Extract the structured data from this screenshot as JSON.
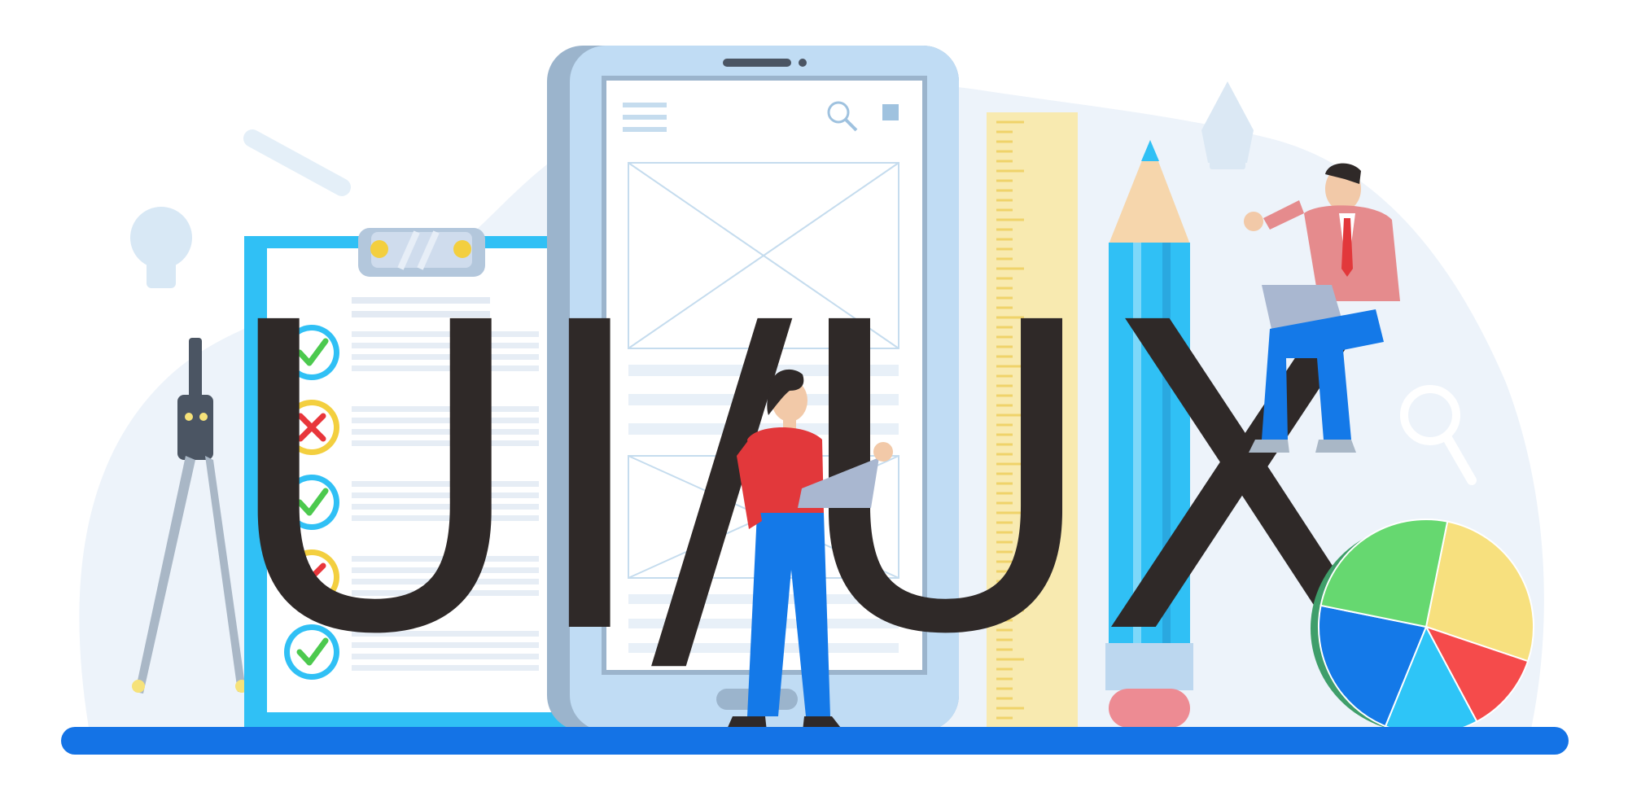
{
  "headline": {
    "text": "UI/UX"
  },
  "checklist": {
    "items": [
      {
        "status": "check"
      },
      {
        "status": "cross"
      },
      {
        "status": "check"
      },
      {
        "status": "cross"
      },
      {
        "status": "check"
      }
    ]
  },
  "pie_chart": {
    "slices": [
      {
        "value": 27,
        "color": "#f7e07e"
      },
      {
        "value": 12,
        "color": "#f54b4b"
      },
      {
        "value": 14,
        "color": "#2ec5f7"
      },
      {
        "value": 22,
        "color": "#1479e8"
      },
      {
        "value": 25,
        "color": "#66d870"
      }
    ]
  },
  "colors": {
    "floor": "#1473e6",
    "letters": "#2f2928",
    "blob": "#edf3fa",
    "phone": "#c0dcf4",
    "clipboard": "#30c0f5",
    "ruler": "#f8eab0",
    "pencil": "#30c0f5"
  },
  "icons": [
    "lightbulb-icon",
    "pen-nib-icon",
    "magnifier-icon",
    "check-icon",
    "cross-icon",
    "hamburger-menu-icon",
    "search-icon",
    "square-icon"
  ]
}
